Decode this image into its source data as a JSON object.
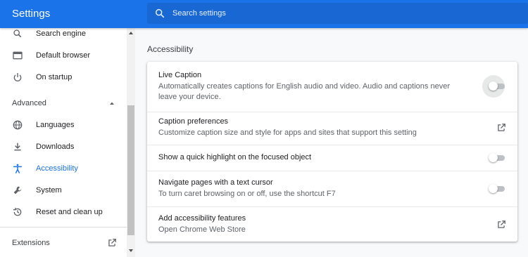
{
  "header": {
    "title": "Settings",
    "search_placeholder": "Search settings",
    "search_value": "",
    "brand_color": "#1a73e8"
  },
  "sidebar": {
    "items_top": [
      {
        "label": "Search engine",
        "icon": "search-icon"
      },
      {
        "label": "Default browser",
        "icon": "browser-window-icon"
      },
      {
        "label": "On startup",
        "icon": "power-icon"
      }
    ],
    "advanced_label": "Advanced",
    "advanced_expanded": true,
    "items_advanced": [
      {
        "label": "Languages",
        "icon": "globe-icon"
      },
      {
        "label": "Downloads",
        "icon": "download-icon"
      },
      {
        "label": "Accessibility",
        "icon": "accessibility-icon",
        "active": true
      },
      {
        "label": "System",
        "icon": "wrench-icon"
      },
      {
        "label": "Reset and clean up",
        "icon": "history-icon"
      }
    ],
    "extensions_label": "Extensions",
    "active_color": "#1a73e8"
  },
  "main": {
    "section_title": "Accessibility",
    "rows": [
      {
        "title": "Live Caption",
        "subtitle": "Automatically creates captions for English audio and video. Audio and captions never leave your device.",
        "control": "toggle",
        "on": false
      },
      {
        "title": "Caption preferences",
        "subtitle": "Customize caption size and style for apps and sites that support this setting",
        "control": "external-link"
      },
      {
        "title": "Show a quick highlight on the focused object",
        "subtitle": "",
        "control": "toggle",
        "on": false
      },
      {
        "title": "Navigate pages with a text cursor",
        "subtitle": "To turn caret browsing on or off, use the shortcut F7",
        "control": "toggle",
        "on": false
      },
      {
        "title": "Add accessibility features",
        "subtitle": "Open Chrome Web Store",
        "control": "external-link"
      }
    ]
  }
}
